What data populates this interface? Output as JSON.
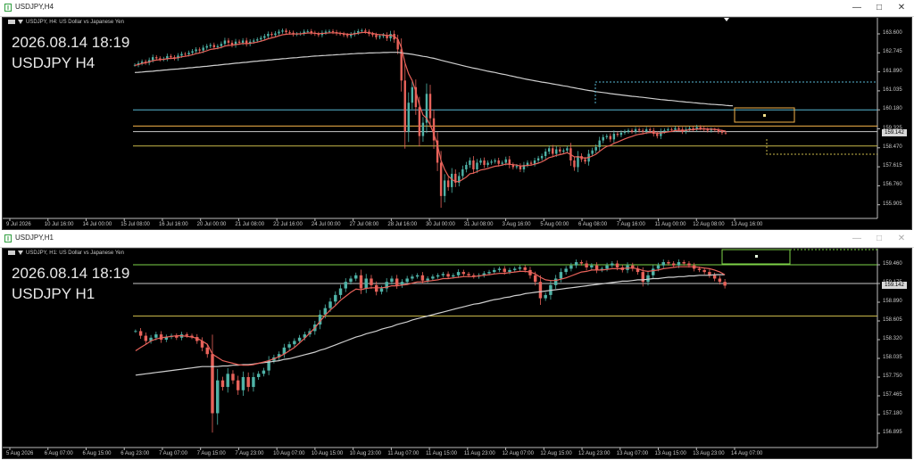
{
  "windows": [
    {
      "id": "h4",
      "title": "USDJPY,H4",
      "active": true,
      "header": "USDJPY, H4:  US Dollar vs Japanese Yen",
      "overlay_date": "2026.08.14 18:19",
      "overlay_symbol": "USDJPY H4",
      "current_price": "159.142",
      "y_labels": [
        "163.600",
        "162.745",
        "161.890",
        "161.035",
        "160.180",
        "159.325",
        "158.470",
        "157.615",
        "156.760",
        "155.905"
      ],
      "x_labels": [
        "9 Jul 2026",
        "10 Jul 16:00",
        "14 Jul 00:00",
        "15 Jul 08:00",
        "16 Jul 16:00",
        "20 Jul 00:00",
        "21 Jul 08:00",
        "22 Jul 16:00",
        "24 Jul 00:00",
        "27 Jul 08:00",
        "28 Jul 16:00",
        "30 Jul 00:00",
        "31 Jul 08:00",
        "3 Aug 16:00",
        "5 Aug 00:00",
        "6 Aug 08:00",
        "7 Aug 16:00",
        "11 Aug 00:00",
        "12 Aug 08:00",
        "13 Aug 16:00"
      ],
      "hlines": [
        {
          "price": 160.18,
          "color": "#57b8d4"
        },
        {
          "price": 159.45,
          "color": "#f4b24a"
        },
        {
          "price": 159.2,
          "color": "#c8c8c8"
        },
        {
          "price": 158.55,
          "color": "#c9b84a"
        }
      ],
      "closes": [
        162.2,
        162.28,
        162.35,
        162.3,
        162.42,
        162.55,
        162.5,
        162.45,
        162.48,
        162.6,
        162.55,
        162.5,
        162.62,
        162.7,
        162.68,
        162.75,
        162.82,
        162.9,
        162.85,
        162.98,
        163.05,
        163.1,
        163.0,
        163.05,
        163.15,
        163.3,
        163.2,
        163.1,
        163.25,
        163.2,
        163.3,
        163.15,
        163.25,
        163.3,
        163.35,
        163.42,
        163.5,
        163.6,
        163.55,
        163.62,
        163.7,
        163.75,
        163.68,
        163.65,
        163.58,
        163.6,
        163.62,
        163.7,
        163.72,
        163.65,
        163.6,
        163.55,
        163.65,
        163.7,
        163.72,
        163.68,
        163.62,
        163.6,
        163.55,
        163.5,
        163.58,
        163.65,
        163.72,
        163.75,
        163.7,
        163.6,
        163.55,
        163.45,
        163.5,
        163.55,
        163.4,
        163.6,
        163.35,
        162.9,
        161.5,
        159.2,
        160.5,
        161.2,
        160.3,
        159.0,
        159.6,
        160.9,
        159.8,
        158.8,
        157.8,
        156.3,
        157.0,
        156.7,
        157.3,
        156.9,
        157.2,
        157.5,
        157.7,
        157.9,
        157.5,
        157.8,
        157.9,
        157.7,
        157.8,
        157.85,
        157.9,
        157.75,
        157.8,
        157.95,
        157.7,
        157.6,
        157.65,
        157.5,
        157.7,
        157.8,
        157.75,
        157.9,
        158.0,
        158.1,
        158.3,
        158.45,
        158.2,
        158.4,
        158.3,
        158.35,
        158.45,
        157.9,
        157.6,
        158.1,
        157.95,
        157.85,
        158.2,
        158.35,
        158.5,
        158.8,
        158.95,
        159.0,
        158.85,
        159.1,
        159.05,
        159.15,
        159.2,
        159.25,
        159.2,
        159.3,
        159.25,
        159.2,
        159.3,
        159.25,
        159.1,
        159.0,
        159.2,
        159.25,
        159.3,
        159.28,
        159.35,
        159.3,
        159.2,
        159.3,
        159.35,
        159.3,
        159.4,
        159.35,
        159.3,
        159.25,
        159.3,
        159.28,
        159.2,
        159.15,
        159.142
      ],
      "ma_fast": [
        162.18,
        162.22,
        162.27,
        162.3,
        162.34,
        162.39,
        162.42,
        162.44,
        162.45,
        162.48,
        162.5,
        162.5,
        162.53,
        162.57,
        162.59,
        162.62,
        162.66,
        162.71,
        162.74,
        162.79,
        162.84,
        162.9,
        162.92,
        162.95,
        162.99,
        163.05,
        163.08,
        163.09,
        163.12,
        163.14,
        163.17,
        163.16,
        163.18,
        163.2,
        163.23,
        163.27,
        163.32,
        163.38,
        163.42,
        163.46,
        163.51,
        163.56,
        163.58,
        163.6,
        163.59,
        163.6,
        163.6,
        163.62,
        163.64,
        163.64,
        163.63,
        163.61,
        163.62,
        163.63,
        163.65,
        163.65,
        163.64,
        163.63,
        163.61,
        163.58,
        163.58,
        163.6,
        163.63,
        163.66,
        163.67,
        163.65,
        163.63,
        163.58,
        163.56,
        163.56,
        163.52,
        163.54,
        163.49,
        163.36,
        162.99,
        162.3,
        161.8,
        161.5,
        161.0,
        160.4,
        159.95,
        159.8,
        159.5,
        159.1,
        158.6,
        157.9,
        157.5,
        157.2,
        157.05,
        156.95,
        156.95,
        157.05,
        157.15,
        157.3,
        157.33,
        157.4,
        157.47,
        157.5,
        157.54,
        157.59,
        157.64,
        157.66,
        157.69,
        157.74,
        157.73,
        157.71,
        157.69,
        157.65,
        157.66,
        157.68,
        157.69,
        157.73,
        157.78,
        157.84,
        157.93,
        158.03,
        158.07,
        158.13,
        158.16,
        158.2,
        158.25,
        158.17,
        158.06,
        158.07,
        158.04,
        158.0,
        158.04,
        158.1,
        158.18,
        158.31,
        158.43,
        158.53,
        158.58,
        158.67,
        158.73,
        158.8,
        158.87,
        158.93,
        158.98,
        159.04,
        159.08,
        159.1,
        159.14,
        159.16,
        159.15,
        159.13,
        159.14,
        159.16,
        159.19,
        159.21,
        159.25,
        159.26,
        159.25,
        159.26,
        159.28,
        159.29,
        159.31,
        159.32,
        159.32,
        159.31,
        159.31,
        159.3,
        159.28,
        159.25,
        159.22
      ],
      "ma_slow": [
        161.86,
        161.87,
        161.88,
        161.9,
        161.91,
        161.92,
        161.94,
        161.95,
        161.97,
        161.98,
        162.0,
        162.01,
        162.02,
        162.04,
        162.05,
        162.07,
        162.08,
        162.1,
        162.11,
        162.13,
        162.14,
        162.16,
        162.18,
        162.19,
        162.21,
        162.23,
        162.24,
        162.26,
        162.28,
        162.29,
        162.31,
        162.32,
        162.34,
        162.36,
        162.37,
        162.39,
        162.4,
        162.42,
        162.43,
        162.45,
        162.46,
        162.48,
        162.49,
        162.51,
        162.52,
        162.53,
        162.55,
        162.56,
        162.57,
        162.59,
        162.6,
        162.61,
        162.62,
        162.63,
        162.64,
        162.65,
        162.66,
        162.67,
        162.68,
        162.69,
        162.7,
        162.71,
        162.72,
        162.72,
        162.73,
        162.74,
        162.74,
        162.75,
        162.75,
        162.76,
        162.76,
        162.77,
        162.77,
        162.77,
        162.75,
        162.72,
        162.7,
        162.68,
        162.65,
        162.62,
        162.59,
        162.57,
        162.53,
        162.5,
        162.46,
        162.41,
        162.37,
        162.33,
        162.29,
        162.25,
        162.21,
        162.17,
        162.13,
        162.1,
        162.06,
        162.03,
        161.99,
        161.96,
        161.92,
        161.89,
        161.86,
        161.82,
        161.79,
        161.76,
        161.72,
        161.69,
        161.65,
        161.62,
        161.58,
        161.55,
        161.52,
        161.49,
        161.46,
        161.43,
        161.41,
        161.38,
        161.35,
        161.32,
        161.29,
        161.26,
        161.24,
        161.2,
        161.17,
        161.14,
        161.11,
        161.08,
        161.05,
        161.03,
        161.0,
        160.98,
        160.96,
        160.94,
        160.91,
        160.89,
        160.87,
        160.85,
        160.83,
        160.81,
        160.79,
        160.78,
        160.76,
        160.74,
        160.72,
        160.7,
        160.68,
        160.66,
        160.64,
        160.63,
        160.61,
        160.6,
        160.58,
        160.56,
        160.55,
        160.53,
        160.52,
        160.5,
        160.49,
        160.47,
        160.46,
        160.44,
        160.43,
        160.42,
        160.41,
        160.4,
        160.38,
        160.37,
        160.36
      ]
    },
    {
      "id": "h1",
      "title": "USDJPY,H1",
      "active": false,
      "header": "USDJPY, H1:  US Dollar vs Japanese Yen",
      "overlay_date": "2026.08.14 18:19",
      "overlay_symbol": "USDJPY H1",
      "current_price": "159.142",
      "y_labels": [
        "159.460",
        "159.175",
        "158.890",
        "158.605",
        "158.320",
        "158.035",
        "157.750",
        "157.465",
        "157.180",
        "156.895"
      ],
      "x_labels": [
        "5 Aug 2026",
        "6 Aug 07:00",
        "6 Aug 15:00",
        "6 Aug 23:00",
        "7 Aug 07:00",
        "7 Aug 15:00",
        "7 Aug 23:00",
        "10 Aug 07:00",
        "10 Aug 15:00",
        "10 Aug 23:00",
        "11 Aug 07:00",
        "11 Aug 15:00",
        "11 Aug 23:00",
        "12 Aug 07:00",
        "12 Aug 15:00",
        "12 Aug 23:00",
        "13 Aug 07:00",
        "13 Aug 15:00",
        "13 Aug 23:00",
        "14 Aug 07:00"
      ],
      "hlines": [
        {
          "price": 159.46,
          "color": "#7ed348"
        },
        {
          "price": 159.175,
          "color": "#c8c8c8"
        },
        {
          "price": 158.68,
          "color": "#c9b84a"
        }
      ],
      "closes": [
        158.45,
        158.38,
        158.3,
        158.35,
        158.4,
        158.32,
        158.36,
        158.38,
        158.35,
        158.4,
        158.38,
        158.36,
        158.3,
        158.2,
        158.1,
        157.2,
        157.7,
        157.6,
        157.8,
        157.7,
        157.55,
        157.75,
        157.6,
        157.75,
        157.8,
        157.85,
        158.0,
        158.05,
        158.1,
        158.2,
        158.25,
        158.3,
        158.35,
        158.4,
        158.45,
        158.55,
        158.7,
        158.8,
        158.9,
        159.0,
        159.1,
        159.2,
        159.25,
        159.3,
        159.1,
        159.25,
        159.15,
        159.05,
        159.1,
        159.2,
        159.25,
        159.15,
        159.2,
        159.25,
        159.28,
        159.3,
        159.22,
        159.25,
        159.28,
        159.3,
        159.32,
        159.28,
        159.3,
        159.35,
        159.32,
        159.3,
        159.28,
        159.3,
        159.33,
        159.35,
        159.38,
        159.4,
        159.35,
        159.38,
        159.4,
        159.42,
        159.38,
        159.3,
        159.2,
        158.95,
        159.0,
        159.15,
        159.25,
        159.35,
        159.4,
        159.45,
        159.5,
        159.48,
        159.42,
        159.45,
        159.38,
        159.4,
        159.45,
        159.48,
        159.42,
        159.38,
        159.45,
        159.4,
        159.35,
        159.2,
        159.3,
        159.4,
        159.45,
        159.5,
        159.48,
        159.45,
        159.5,
        159.48,
        159.45,
        159.4,
        159.38,
        159.35,
        159.3,
        159.25,
        159.2,
        159.142
      ],
      "ma_fast": [
        158.15,
        158.2,
        158.25,
        158.3,
        158.33,
        158.35,
        158.36,
        158.37,
        158.38,
        158.38,
        158.37,
        158.36,
        158.34,
        158.3,
        158.25,
        158.1,
        158.05,
        158.0,
        157.98,
        157.96,
        157.94,
        157.93,
        157.93,
        157.94,
        157.96,
        157.98,
        158.0,
        158.03,
        158.06,
        158.1,
        158.15,
        158.2,
        158.27,
        158.34,
        158.42,
        158.5,
        158.6,
        158.69,
        158.77,
        158.84,
        158.92,
        158.98,
        159.04,
        159.09,
        159.08,
        159.1,
        159.11,
        159.11,
        159.11,
        159.12,
        159.14,
        159.14,
        159.15,
        159.16,
        159.18,
        159.2,
        159.2,
        159.21,
        159.22,
        159.23,
        159.25,
        159.25,
        159.26,
        159.27,
        159.28,
        159.28,
        159.28,
        159.29,
        159.3,
        159.31,
        159.32,
        159.33,
        159.33,
        159.34,
        159.35,
        159.36,
        159.36,
        159.35,
        159.32,
        159.27,
        159.23,
        159.22,
        159.22,
        159.24,
        159.26,
        159.29,
        159.32,
        159.35,
        159.36,
        159.38,
        159.38,
        159.38,
        159.39,
        159.4,
        159.4,
        159.4,
        159.41,
        159.41,
        159.4,
        159.37,
        159.36,
        159.37,
        159.38,
        159.4,
        159.41,
        159.42,
        159.43,
        159.43,
        159.43,
        159.43,
        159.42,
        159.41,
        159.4,
        159.38,
        159.35,
        159.31
      ],
      "ma_slow": [
        157.78,
        157.79,
        157.8,
        157.81,
        157.82,
        157.83,
        157.84,
        157.85,
        157.86,
        157.87,
        157.88,
        157.89,
        157.9,
        157.91,
        157.91,
        157.91,
        157.91,
        157.92,
        157.92,
        157.93,
        157.93,
        157.94,
        157.94,
        157.95,
        157.96,
        157.97,
        157.98,
        157.99,
        158.0,
        158.02,
        158.03,
        158.05,
        158.07,
        158.09,
        158.11,
        158.13,
        158.16,
        158.18,
        158.21,
        158.24,
        158.27,
        158.3,
        158.33,
        158.36,
        158.38,
        158.41,
        158.43,
        158.45,
        158.48,
        158.5,
        158.52,
        158.55,
        158.57,
        158.59,
        158.62,
        158.64,
        158.66,
        158.68,
        158.7,
        158.72,
        158.74,
        158.76,
        158.78,
        158.8,
        158.82,
        158.84,
        158.86,
        158.87,
        158.89,
        158.91,
        158.93,
        158.94,
        158.96,
        158.97,
        158.99,
        159.0,
        159.02,
        159.03,
        159.04,
        159.05,
        159.06,
        159.07,
        159.08,
        159.09,
        159.1,
        159.11,
        159.12,
        159.13,
        159.14,
        159.15,
        159.16,
        159.17,
        159.18,
        159.19,
        159.2,
        159.21,
        159.21,
        159.22,
        159.23,
        159.23,
        159.24,
        159.25,
        159.25,
        159.26,
        159.27,
        159.27,
        159.28,
        159.28,
        159.29,
        159.29,
        159.3,
        159.3,
        159.3,
        159.31,
        159.31,
        159.31
      ]
    }
  ],
  "colors": {
    "bull": "#4fb3a7",
    "bear": "#e8625a",
    "ma_fast": "#e8625a",
    "ma_slow": "#cfcfcf"
  },
  "icons": [
    "window-app-icon",
    "minimize-icon",
    "maximize-icon",
    "close-icon",
    "flag-icon",
    "menu-triangle-icon"
  ]
}
